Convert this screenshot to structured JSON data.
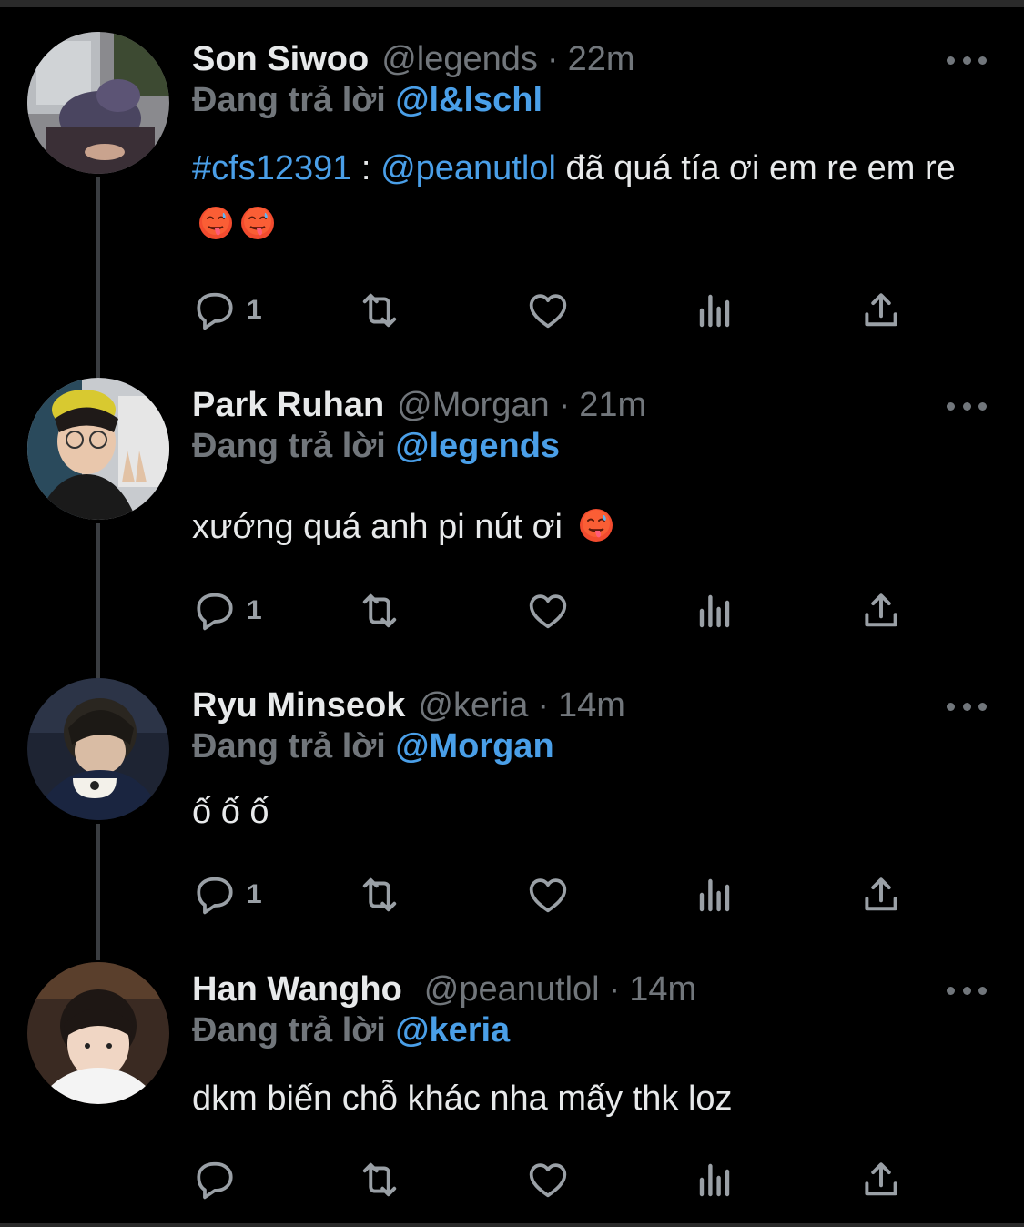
{
  "replying_prefix": "Đang trả lời",
  "icons": {
    "reply": "reply-icon",
    "retweet": "retweet-icon",
    "like": "heart-icon",
    "views": "analytics-icon",
    "share": "share-icon",
    "more": "more-icon",
    "emoji": "hot-face-emoji"
  },
  "colors": {
    "background": "#000000",
    "text": "#e7e9ea",
    "muted": "#71767b",
    "link": "#4a9fe8"
  },
  "tweets": [
    {
      "name": "Son Siwoo",
      "handle": "@legends",
      "time": "22m",
      "reply_to": "@l&lschl",
      "hashtag": "#cfs12391",
      "sep": " : ",
      "mention": "@peanutlol",
      "text": " đã quá tía ơi em re em re",
      "emoji_count": 2,
      "reply_count": "1"
    },
    {
      "name": "Park Ruhan",
      "handle": "@Morgan",
      "time": "21m",
      "reply_to": "@legends",
      "text": "xướng quá anh pi nút ơi",
      "emoji_count": 1,
      "reply_count": "1"
    },
    {
      "name": "Ryu Minseok",
      "handle": "@keria",
      "time": "14m",
      "reply_to": "@Morgan",
      "text": "ố ố ố",
      "emoji_count": 0,
      "reply_count": "1"
    },
    {
      "name": "Han Wangho",
      "handle": "@peanutlol",
      "time": "14m",
      "reply_to": "@keria",
      "text": "dkm biến chỗ khác nha mấy thk loz",
      "emoji_count": 0,
      "reply_count": ""
    }
  ]
}
